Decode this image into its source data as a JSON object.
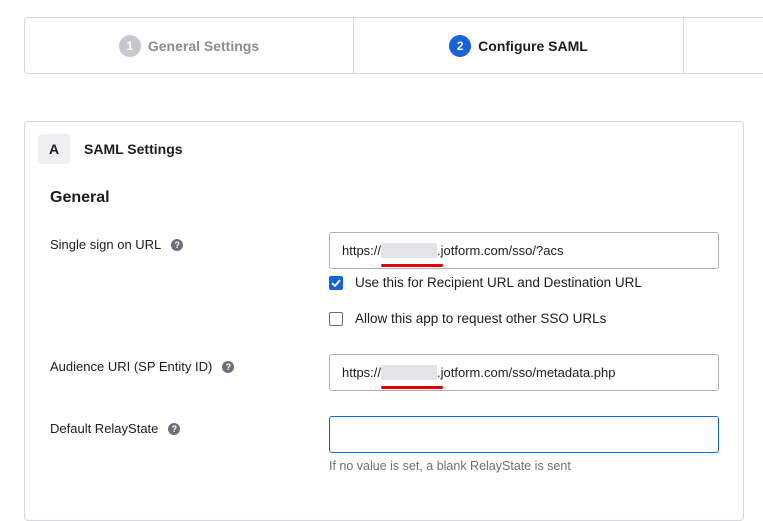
{
  "stepper": {
    "steps": [
      {
        "number": "1",
        "label": "General Settings",
        "state": "completed"
      },
      {
        "number": "2",
        "label": "Configure SAML",
        "state": "active"
      }
    ]
  },
  "section": {
    "badge": "A",
    "title": "SAML Settings",
    "subheading": "General"
  },
  "fields": {
    "sso_url": {
      "label": "Single sign on URL",
      "value_prefix": "https://",
      "value_suffix": ".jotform.com/sso/?acs"
    },
    "recipient_checkbox": {
      "label": "Use this for Recipient URL and Destination URL",
      "checked": true
    },
    "other_sso_checkbox": {
      "label": "Allow this app to request other SSO URLs",
      "checked": false
    },
    "audience_uri": {
      "label": "Audience URI (SP Entity ID)",
      "value_prefix": "https://",
      "value_suffix": ".jotform.com/sso/metadata.php"
    },
    "relay_state": {
      "label": "Default RelayState",
      "value": "",
      "hint": "If no value is set, a blank RelayState is sent"
    }
  },
  "help_icon_glyph": "?",
  "colors": {
    "accent": "#1662dd",
    "redaction_underline": "#e30000",
    "muted_text": "#6e6e78"
  }
}
